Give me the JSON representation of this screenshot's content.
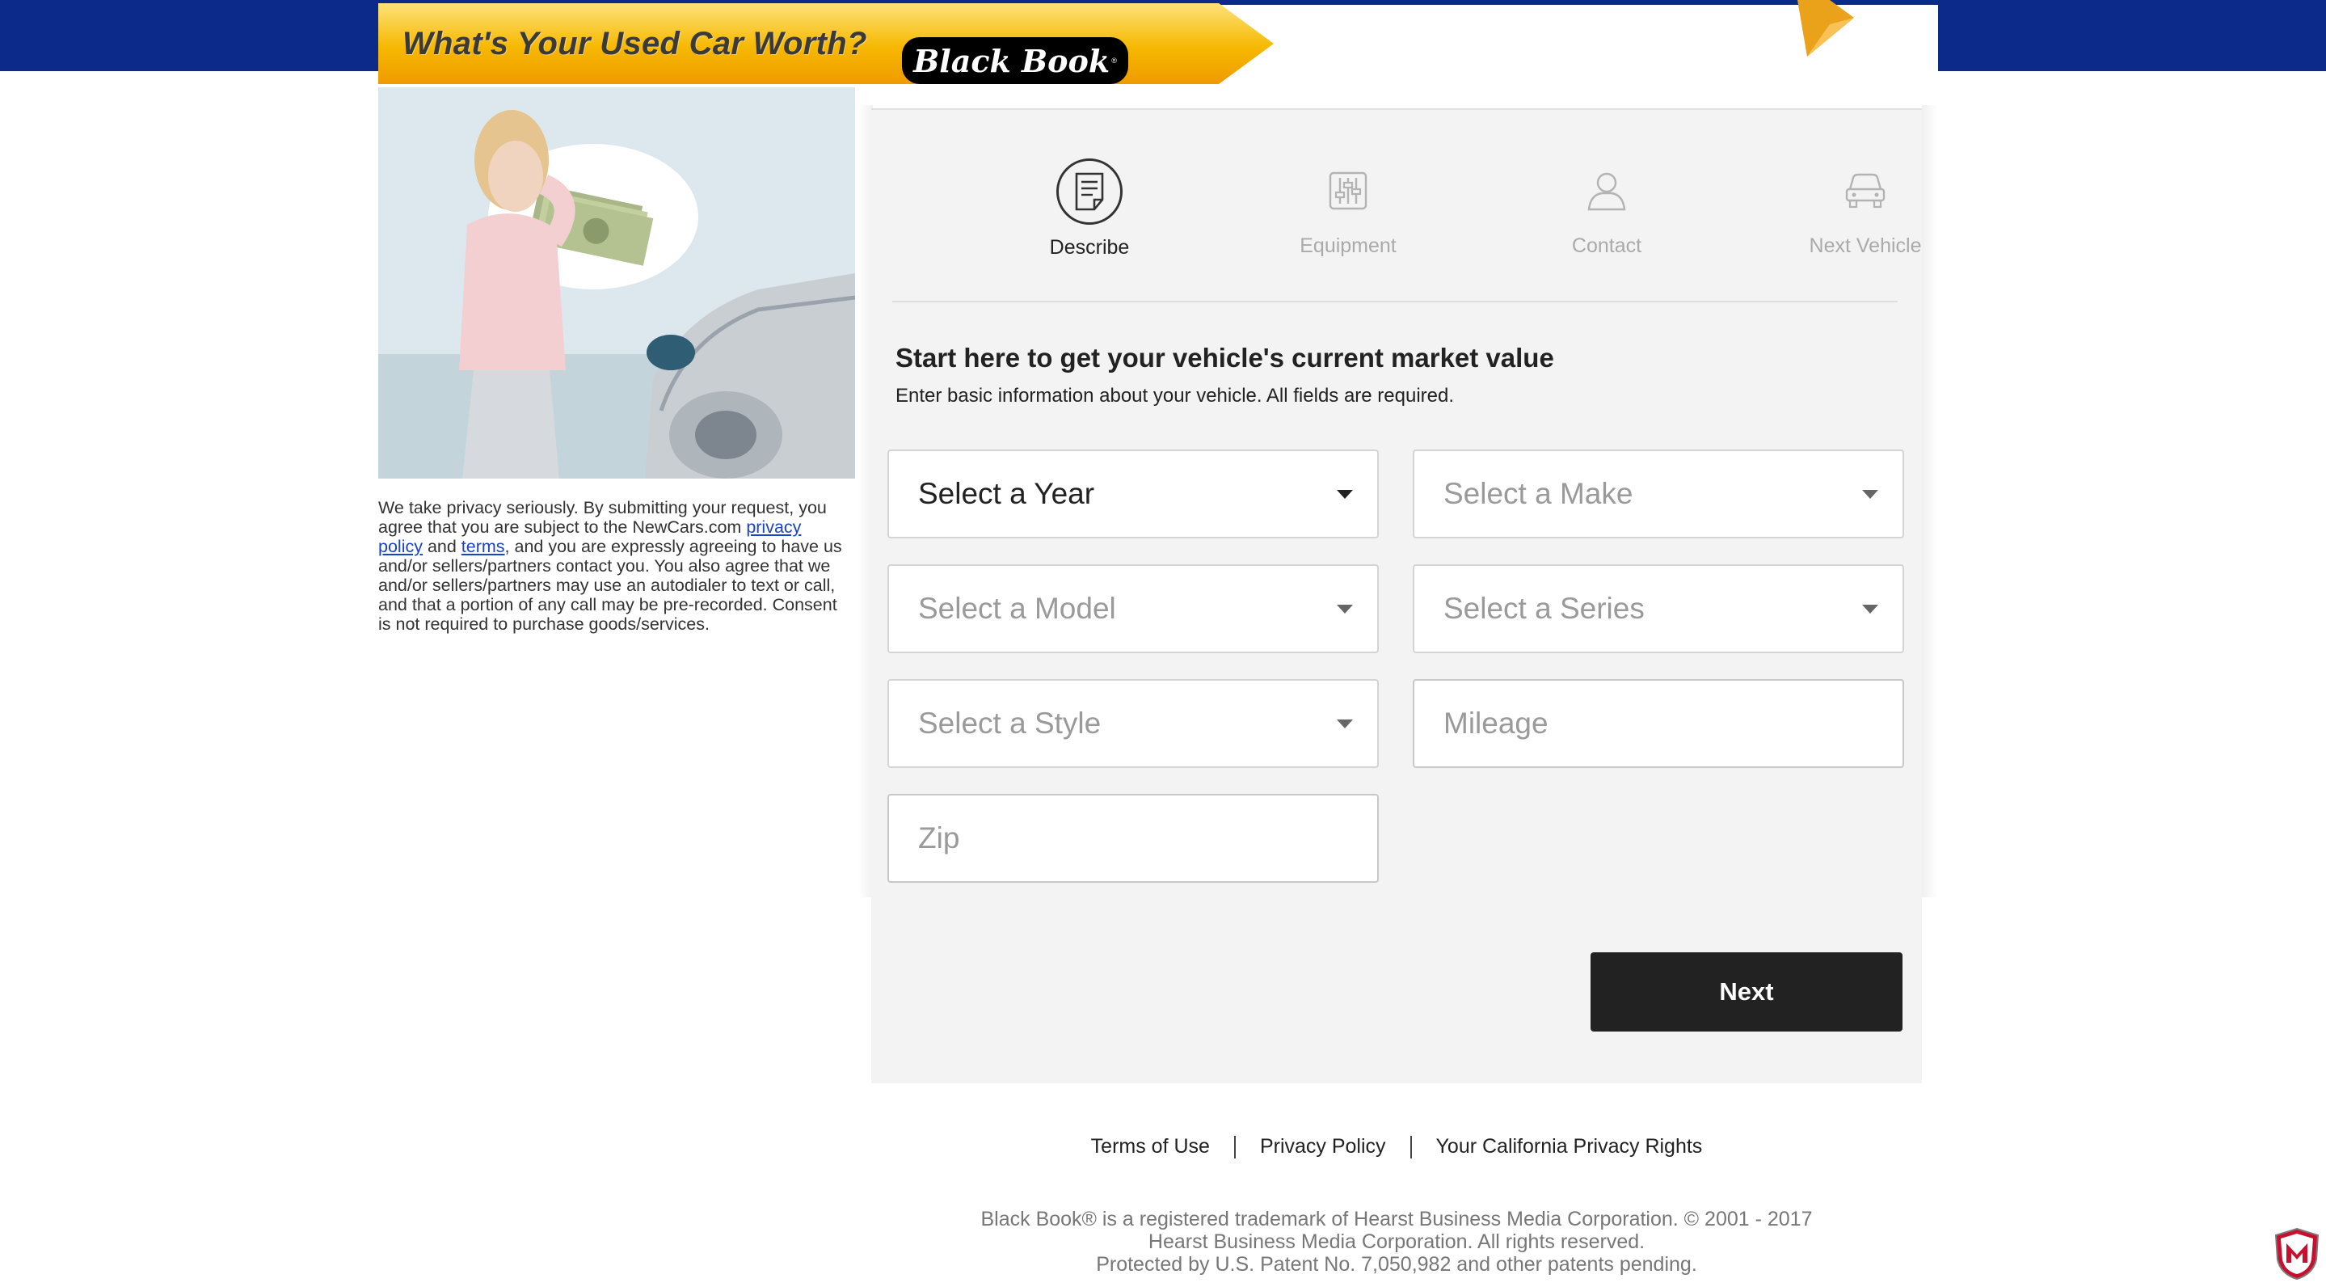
{
  "header": {
    "banner_title": "What's Your Used Car Worth?",
    "logo_text": "Black Book",
    "logo_mark": "®"
  },
  "privacy": {
    "text_1": "We take privacy seriously. By submitting your request, you agree that you are subject to the NewCars.com ",
    "link_privacy": "privacy policy",
    "text_2": " and ",
    "link_terms": "terms",
    "text_3": ", and you are expressly agreeing to have us and/or sellers/partners contact you. You also agree that we and/or sellers/partners may use an autodialer to text or call, and that a portion of any call may be pre-recorded. Consent is not required to purchase goods/services."
  },
  "steps": [
    {
      "label": "Describe",
      "icon": "document-icon",
      "active": true
    },
    {
      "label": "Equipment",
      "icon": "sliders-icon",
      "active": false
    },
    {
      "label": "Contact",
      "icon": "person-icon",
      "active": false
    },
    {
      "label": "Next Vehicle",
      "icon": "car-icon",
      "active": false
    }
  ],
  "form": {
    "heading": "Start here to get your vehicle's current market value",
    "subheading": "Enter basic information about your vehicle. All fields are required.",
    "year_label": "Select a Year",
    "make_label": "Select a Make",
    "model_label": "Select a Model",
    "series_label": "Select a Series",
    "style_label": "Select a Style",
    "mileage_placeholder": "Mileage",
    "zip_placeholder": "Zip",
    "next_label": "Next"
  },
  "footer": {
    "links": [
      "Terms of Use",
      "Privacy Policy",
      "Your California Privacy Rights"
    ],
    "legal_1": "Black Book® is a registered trademark of Hearst Business Media Corporation. © 2001 - 2017 Hearst Business Media Corporation. All rights reserved.",
    "legal_2": "Protected by U.S. Patent No. 7,050,982 and other patents pending."
  },
  "colors": {
    "top_band": "#0b2a8a",
    "banner_gold": "#f6b800",
    "panel_bg": "#f3f3f3",
    "button_bg": "#222222",
    "link": "#1a44c4"
  }
}
